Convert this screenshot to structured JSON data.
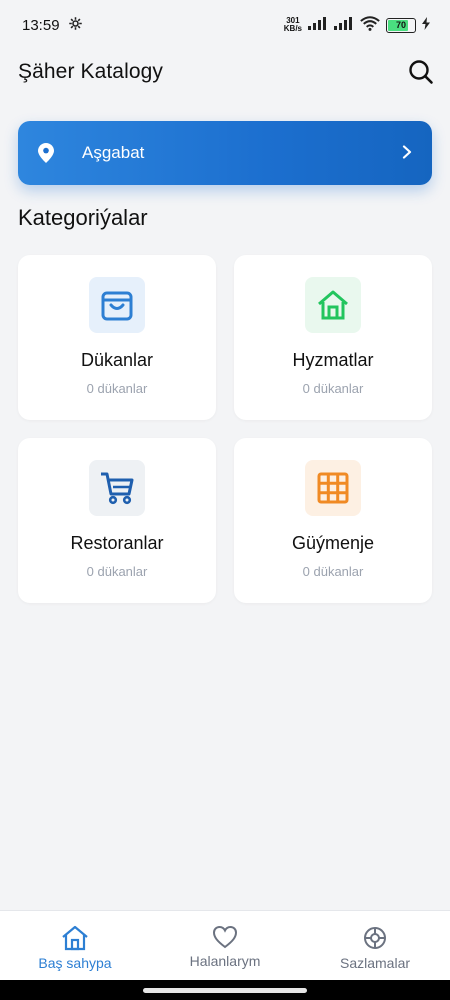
{
  "status_bar": {
    "time": "13:59",
    "net_speed_value": "301",
    "net_speed_unit": "KB/s",
    "battery_level": "70"
  },
  "header": {
    "title": "Şäher Katalogy",
    "search_icon": "search-icon"
  },
  "location": {
    "city": "Aşgabat",
    "icon": "location-pin-icon"
  },
  "categories_title": "Kategoriýalar",
  "categories": [
    {
      "label": "Dükanlar",
      "count": "0 dükanlar",
      "icon": "store-icon",
      "color": "#2d7fd3",
      "bg": "#e6f0fb"
    },
    {
      "label": "Hyzmatlar",
      "count": "0 dükanlar",
      "icon": "home-icon",
      "color": "#22c55e",
      "bg": "#e9f8ee"
    },
    {
      "label": "Restoranlar",
      "count": "0 dükanlar",
      "icon": "cart-icon",
      "color": "#1f5fae",
      "bg": "#eef1f4"
    },
    {
      "label": "Güýmenje",
      "count": "0 dükanlar",
      "icon": "grid-icon",
      "color": "#f08a24",
      "bg": "#fdf0e3"
    }
  ],
  "nav": [
    {
      "label": "Baş sahypa",
      "icon": "home-icon",
      "active": true
    },
    {
      "label": "Halanlarym",
      "icon": "heart-icon",
      "active": false
    },
    {
      "label": "Sazlamalar",
      "icon": "settings-icon",
      "active": false
    }
  ],
  "colors": {
    "accent": "#2d7fd3",
    "background": "#f3f4f6"
  }
}
